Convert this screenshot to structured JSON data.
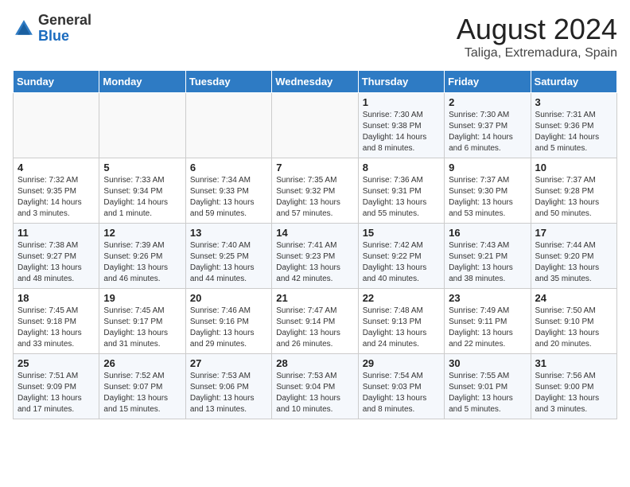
{
  "header": {
    "logo_general": "General",
    "logo_blue": "Blue",
    "title": "August 2024",
    "subtitle": "Taliga, Extremadura, Spain"
  },
  "days_of_week": [
    "Sunday",
    "Monday",
    "Tuesday",
    "Wednesday",
    "Thursday",
    "Friday",
    "Saturday"
  ],
  "weeks": [
    [
      {
        "day": "",
        "info": ""
      },
      {
        "day": "",
        "info": ""
      },
      {
        "day": "",
        "info": ""
      },
      {
        "day": "",
        "info": ""
      },
      {
        "day": "1",
        "info": "Sunrise: 7:30 AM\nSunset: 9:38 PM\nDaylight: 14 hours and 8 minutes."
      },
      {
        "day": "2",
        "info": "Sunrise: 7:30 AM\nSunset: 9:37 PM\nDaylight: 14 hours and 6 minutes."
      },
      {
        "day": "3",
        "info": "Sunrise: 7:31 AM\nSunset: 9:36 PM\nDaylight: 14 hours and 5 minutes."
      }
    ],
    [
      {
        "day": "4",
        "info": "Sunrise: 7:32 AM\nSunset: 9:35 PM\nDaylight: 14 hours and 3 minutes."
      },
      {
        "day": "5",
        "info": "Sunrise: 7:33 AM\nSunset: 9:34 PM\nDaylight: 14 hours and 1 minute."
      },
      {
        "day": "6",
        "info": "Sunrise: 7:34 AM\nSunset: 9:33 PM\nDaylight: 13 hours and 59 minutes."
      },
      {
        "day": "7",
        "info": "Sunrise: 7:35 AM\nSunset: 9:32 PM\nDaylight: 13 hours and 57 minutes."
      },
      {
        "day": "8",
        "info": "Sunrise: 7:36 AM\nSunset: 9:31 PM\nDaylight: 13 hours and 55 minutes."
      },
      {
        "day": "9",
        "info": "Sunrise: 7:37 AM\nSunset: 9:30 PM\nDaylight: 13 hours and 53 minutes."
      },
      {
        "day": "10",
        "info": "Sunrise: 7:37 AM\nSunset: 9:28 PM\nDaylight: 13 hours and 50 minutes."
      }
    ],
    [
      {
        "day": "11",
        "info": "Sunrise: 7:38 AM\nSunset: 9:27 PM\nDaylight: 13 hours and 48 minutes."
      },
      {
        "day": "12",
        "info": "Sunrise: 7:39 AM\nSunset: 9:26 PM\nDaylight: 13 hours and 46 minutes."
      },
      {
        "day": "13",
        "info": "Sunrise: 7:40 AM\nSunset: 9:25 PM\nDaylight: 13 hours and 44 minutes."
      },
      {
        "day": "14",
        "info": "Sunrise: 7:41 AM\nSunset: 9:23 PM\nDaylight: 13 hours and 42 minutes."
      },
      {
        "day": "15",
        "info": "Sunrise: 7:42 AM\nSunset: 9:22 PM\nDaylight: 13 hours and 40 minutes."
      },
      {
        "day": "16",
        "info": "Sunrise: 7:43 AM\nSunset: 9:21 PM\nDaylight: 13 hours and 38 minutes."
      },
      {
        "day": "17",
        "info": "Sunrise: 7:44 AM\nSunset: 9:20 PM\nDaylight: 13 hours and 35 minutes."
      }
    ],
    [
      {
        "day": "18",
        "info": "Sunrise: 7:45 AM\nSunset: 9:18 PM\nDaylight: 13 hours and 33 minutes."
      },
      {
        "day": "19",
        "info": "Sunrise: 7:45 AM\nSunset: 9:17 PM\nDaylight: 13 hours and 31 minutes."
      },
      {
        "day": "20",
        "info": "Sunrise: 7:46 AM\nSunset: 9:16 PM\nDaylight: 13 hours and 29 minutes."
      },
      {
        "day": "21",
        "info": "Sunrise: 7:47 AM\nSunset: 9:14 PM\nDaylight: 13 hours and 26 minutes."
      },
      {
        "day": "22",
        "info": "Sunrise: 7:48 AM\nSunset: 9:13 PM\nDaylight: 13 hours and 24 minutes."
      },
      {
        "day": "23",
        "info": "Sunrise: 7:49 AM\nSunset: 9:11 PM\nDaylight: 13 hours and 22 minutes."
      },
      {
        "day": "24",
        "info": "Sunrise: 7:50 AM\nSunset: 9:10 PM\nDaylight: 13 hours and 20 minutes."
      }
    ],
    [
      {
        "day": "25",
        "info": "Sunrise: 7:51 AM\nSunset: 9:09 PM\nDaylight: 13 hours and 17 minutes."
      },
      {
        "day": "26",
        "info": "Sunrise: 7:52 AM\nSunset: 9:07 PM\nDaylight: 13 hours and 15 minutes."
      },
      {
        "day": "27",
        "info": "Sunrise: 7:53 AM\nSunset: 9:06 PM\nDaylight: 13 hours and 13 minutes."
      },
      {
        "day": "28",
        "info": "Sunrise: 7:53 AM\nSunset: 9:04 PM\nDaylight: 13 hours and 10 minutes."
      },
      {
        "day": "29",
        "info": "Sunrise: 7:54 AM\nSunset: 9:03 PM\nDaylight: 13 hours and 8 minutes."
      },
      {
        "day": "30",
        "info": "Sunrise: 7:55 AM\nSunset: 9:01 PM\nDaylight: 13 hours and 5 minutes."
      },
      {
        "day": "31",
        "info": "Sunrise: 7:56 AM\nSunset: 9:00 PM\nDaylight: 13 hours and 3 minutes."
      }
    ]
  ]
}
